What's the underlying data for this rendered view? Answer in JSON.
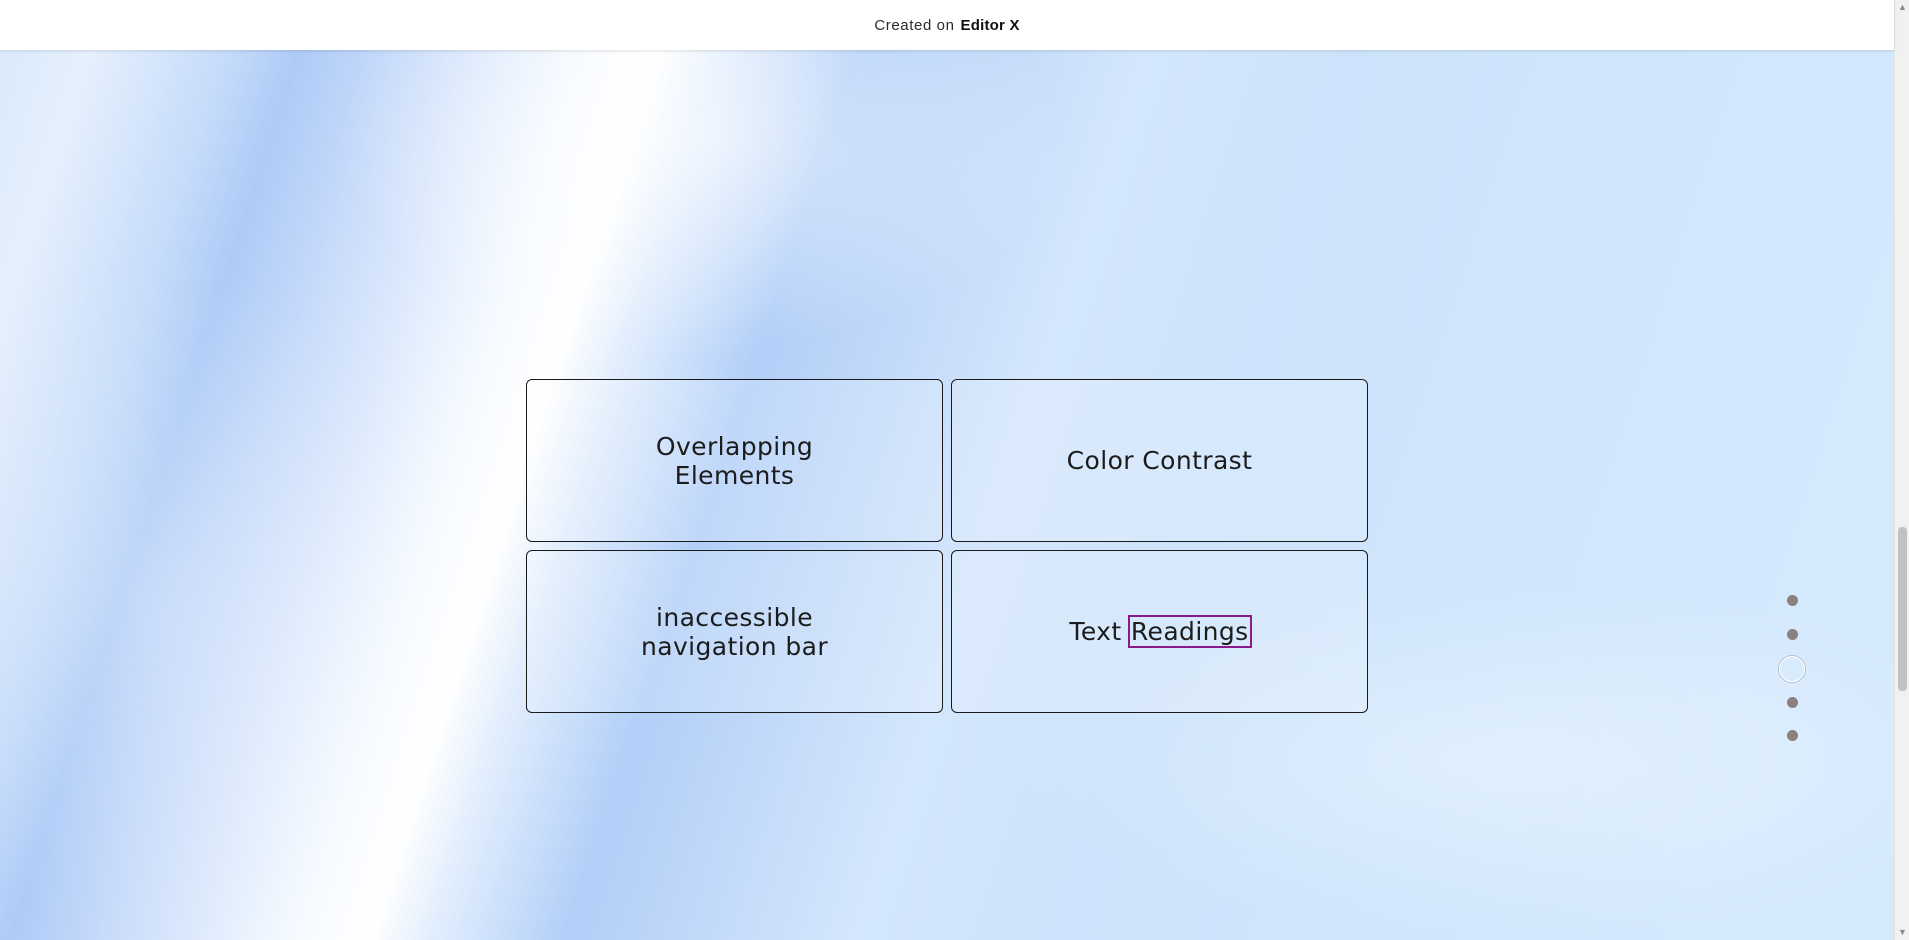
{
  "banner": {
    "prefix": "Created on",
    "brand": "Editor X"
  },
  "cards": [
    {
      "label": "Overlapping\nElements"
    },
    {
      "label": "Color Contrast"
    },
    {
      "label": "inaccessible\nnavigation bar"
    },
    {
      "label_part1": "Text ",
      "label_part2": "Readings"
    }
  ],
  "section_nav": {
    "total": 5,
    "active_index": 2
  },
  "scrollbar": {
    "up_arrow": "▲",
    "down_arrow": "▼"
  },
  "colors": {
    "focus_outline": "#8a1a8a",
    "nav_dot": "#8c7f7f",
    "card_border": "#1a1a1a"
  }
}
